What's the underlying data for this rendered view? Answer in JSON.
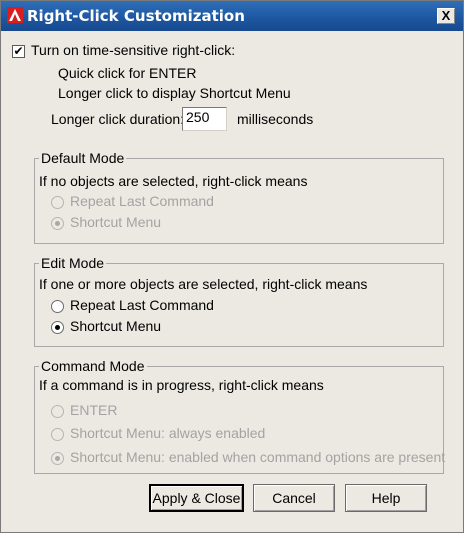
{
  "window": {
    "title": "Right-Click Customization",
    "close_glyph": "X"
  },
  "time_sensitive": {
    "checkbox_label": "Turn on time-sensitive right-click:",
    "checked": true,
    "line1": "Quick click for ENTER",
    "line2": "Longer click to display Shortcut Menu",
    "duration_label": "Longer click duration:",
    "duration_value": "250",
    "duration_unit": "milliseconds"
  },
  "default_mode": {
    "legend": "Default Mode",
    "description": "If no objects are selected, right-click means",
    "options": [
      "Repeat Last Command",
      "Shortcut Menu"
    ],
    "selected": 1,
    "enabled": false
  },
  "edit_mode": {
    "legend": "Edit Mode",
    "description": "If one or more objects are selected, right-click means",
    "options": [
      "Repeat Last Command",
      "Shortcut Menu"
    ],
    "selected": 1,
    "enabled": true
  },
  "command_mode": {
    "legend": "Command Mode",
    "description": "If a command is in progress, right-click means",
    "options": [
      "ENTER",
      "Shortcut Menu: always enabled",
      "Shortcut Menu: enabled when command options are present"
    ],
    "selected": 2,
    "enabled": false
  },
  "buttons": {
    "apply_close": "Apply & Close",
    "cancel": "Cancel",
    "help": "Help"
  }
}
